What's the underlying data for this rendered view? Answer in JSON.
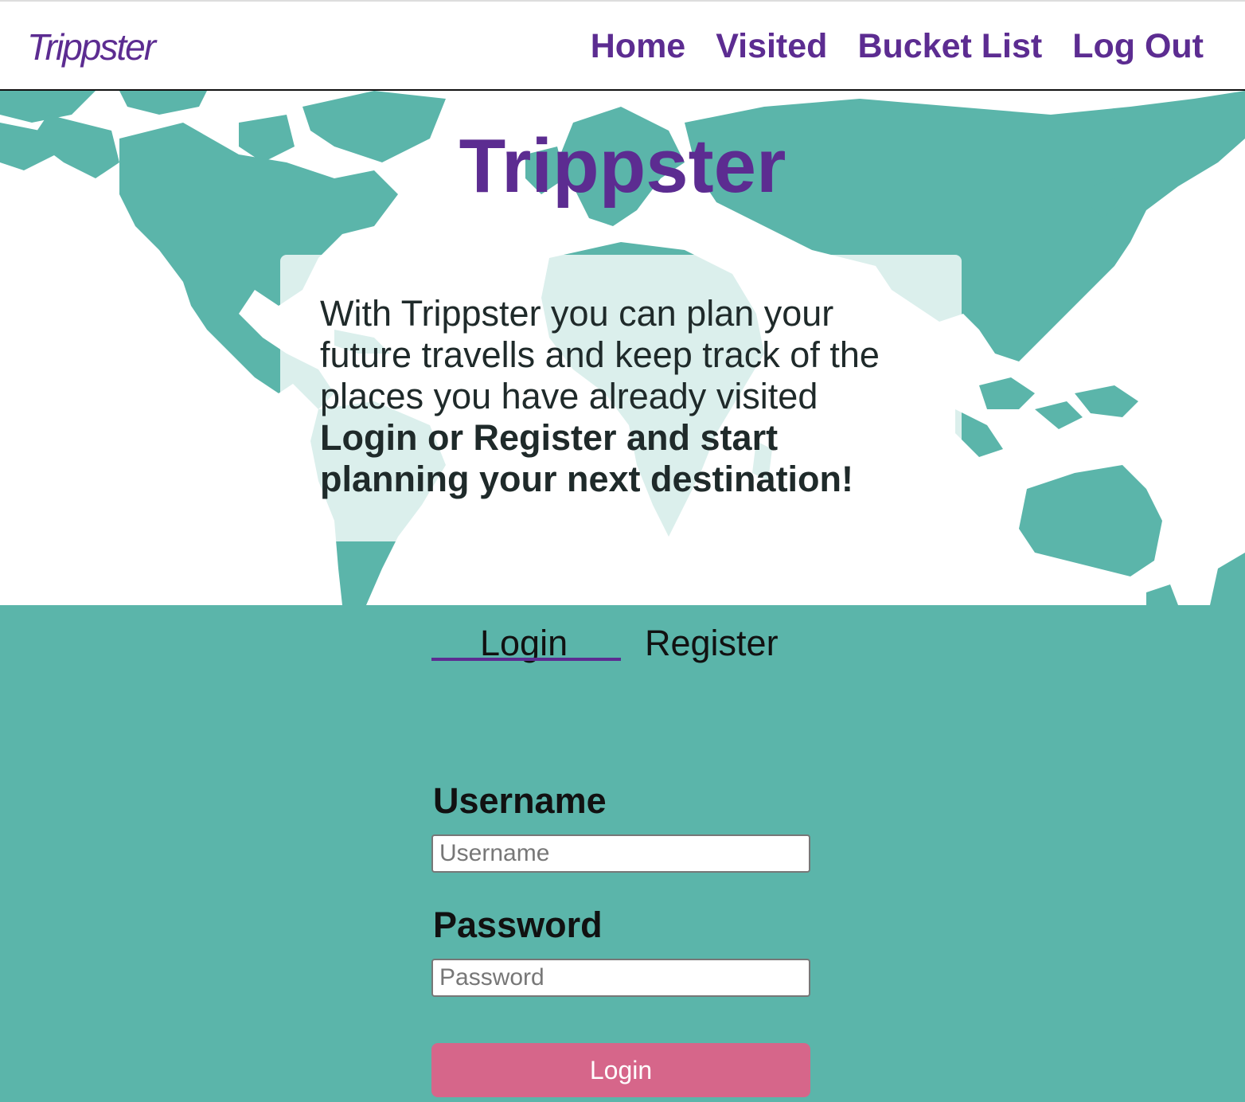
{
  "header": {
    "brand": "Trippster",
    "nav": [
      "Home",
      "Visited",
      "Bucket List",
      "Log Out"
    ]
  },
  "hero": {
    "title": "Trippster",
    "intro": "With Trippster you can plan your future travells and keep track of the places you have already visited",
    "cta": "Login or Register and start planning your next destination!"
  },
  "auth": {
    "tabs": {
      "login": "Login",
      "register": "Register",
      "active": "login"
    },
    "username_label": "Username",
    "username_placeholder": "Username",
    "username_value": "",
    "password_label": "Password",
    "password_placeholder": "Password",
    "password_value": "",
    "submit_label": "Login"
  },
  "colors": {
    "brand_purple": "#5c2c91",
    "map_teal": "#5bb5aa",
    "button_pink": "#d6668a"
  },
  "icons": {
    "background": "world-map-image"
  }
}
